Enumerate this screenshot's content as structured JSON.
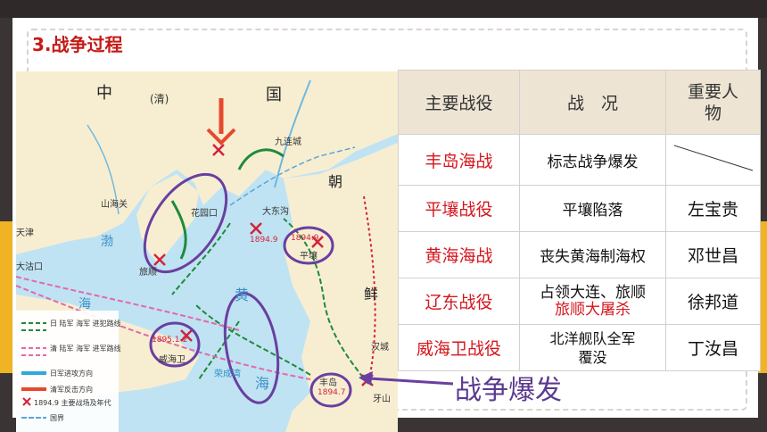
{
  "section_title": "3.战争过程",
  "map": {
    "labels": {
      "zhong": "中",
      "qing": "(清)",
      "guo": "国",
      "chao": "朝",
      "xian": "鲜",
      "bohai": "渤",
      "hai_bo": "海",
      "huang": "黄",
      "hai_huang": "海",
      "shanhaiguan": "山海关",
      "tianjin": "天津",
      "dagukou": "大沽口",
      "huayuankou": "花园口",
      "lushun": "旅顺",
      "weihaiwei": "威海卫",
      "dadonggou": "大东沟",
      "pingrang": "平壤",
      "hancheng": "汉城",
      "fengdao": "丰岛",
      "jiuliancheng": "九连城",
      "rongcheng": "荣成湾",
      "yashan": "牙山",
      "date_pingrang": "1894.9",
      "date_dadonggou": "1894.9",
      "date_weihai": "1895.1-2",
      "date_fengdao": "1894.7"
    },
    "legend": {
      "jp_route": "日 陆军 海军 进犯路线",
      "qing_route": "清 陆军 海军 进军路线",
      "jp_attack": "日军进攻方向",
      "qing_counter": "清军反击方向",
      "battle_site": "1894.9 主要战场及年代",
      "border": "国界"
    }
  },
  "table": {
    "headers": [
      "主要战役",
      "战　况",
      "重要人物"
    ],
    "rows": [
      {
        "battle": "丰岛海战",
        "cond": "标志战争爆发",
        "person": ""
      },
      {
        "battle": "平壤战役",
        "cond": "平壤陷落",
        "person": "左宝贵"
      },
      {
        "battle": "黄海海战",
        "cond": "丧失黄海制海权",
        "person": "邓世昌"
      },
      {
        "battle": "辽东战役",
        "cond_line1": "占领大连、旅顺",
        "cond_line2": "旅顺大屠杀",
        "person": "徐邦道"
      },
      {
        "battle": "威海卫战役",
        "cond_line1": "北洋舰队全军",
        "cond_line2": "覆没",
        "person": "丁汝昌"
      }
    ]
  },
  "annotation": "战争爆发",
  "colors": {
    "accent_red": "#d4171e",
    "purple": "#6a3fa0",
    "yellow": "#f0b324",
    "header_bg": "#ede4d4"
  }
}
